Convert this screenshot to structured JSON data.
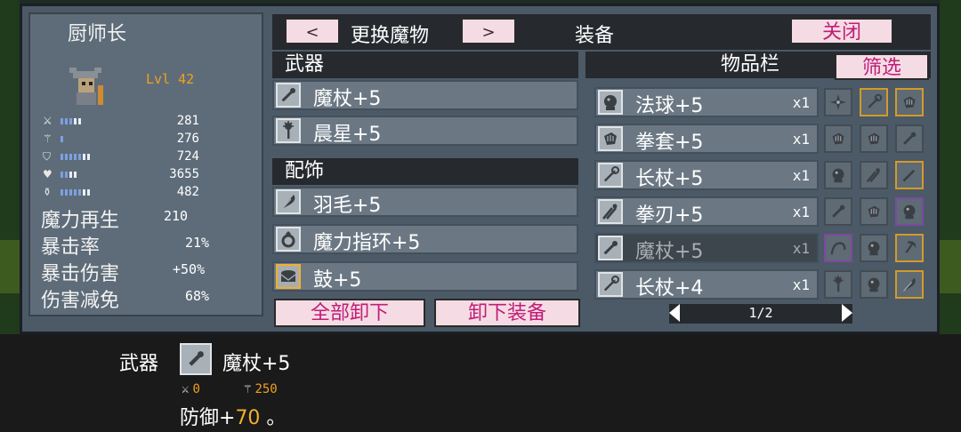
{
  "character": {
    "name": "厨师长",
    "level": "Lvl 42",
    "stats": [
      {
        "icon": "sword-icon",
        "glyph": "⚔",
        "value": "281",
        "fill": 0.45
      },
      {
        "icon": "staff-icon",
        "glyph": "⚚",
        "value": "276",
        "fill": 0.1
      },
      {
        "icon": "shield-icon",
        "glyph": "⛉",
        "value": "724",
        "fill": 0.6
      },
      {
        "icon": "heart-icon",
        "glyph": "♥",
        "value": "3655",
        "fill": 0.4
      },
      {
        "icon": "potion-icon",
        "glyph": "⚱",
        "value": "482",
        "fill": 0.65
      }
    ],
    "attributes": [
      {
        "label": "魔力再生",
        "value": "210"
      },
      {
        "label": "暴击率",
        "value": "21%"
      },
      {
        "label": "暴击伤害",
        "value": "+50%"
      },
      {
        "label": "伤害减免",
        "value": "68%"
      }
    ]
  },
  "header": {
    "prev": "<",
    "change_label": "更换魔物",
    "next": ">",
    "title": "装备",
    "close": "关闭"
  },
  "equipment": {
    "weapon_header": "武器",
    "weapons": [
      {
        "label": "魔杖+5",
        "icon": "wand-icon"
      },
      {
        "label": "晨星+5",
        "icon": "morningstar-icon"
      }
    ],
    "accessory_header": "配饰",
    "accessories": [
      {
        "label": "羽毛+5",
        "icon": "feather-icon",
        "selected": false
      },
      {
        "label": "魔力指环+5",
        "icon": "ring-icon",
        "selected": false
      },
      {
        "label": "鼓+5",
        "icon": "drum-icon",
        "selected": true
      }
    ],
    "unequip_all": "全部卸下",
    "unequip": "卸下装备"
  },
  "inventory": {
    "title": "物品栏",
    "filter": "筛选",
    "items": [
      {
        "label": "法球+5",
        "qty": "x1",
        "icon": "orb-icon",
        "dim": false
      },
      {
        "label": "拳套+5",
        "qty": "x1",
        "icon": "gauntlet-icon",
        "dim": false
      },
      {
        "label": "长杖+5",
        "qty": "x1",
        "icon": "staff-icon",
        "dim": false
      },
      {
        "label": "拳刃+5",
        "qty": "x1",
        "icon": "claw-icon",
        "dim": false
      },
      {
        "label": "魔杖+5",
        "qty": "x1",
        "icon": "wand-icon",
        "dim": true
      },
      {
        "label": "长杖+4",
        "qty": "x1",
        "icon": "staff-icon",
        "dim": false
      }
    ],
    "grid_icons": [
      "shuriken-icon",
      "staff-icon",
      "gauntlet-icon",
      "gauntlet-icon",
      "gauntlet-icon",
      "wand-icon",
      "orb-icon",
      "claw-icon",
      "sword-icon",
      "wand-icon",
      "gauntlet-icon",
      "orb-icon",
      "whip-icon",
      "orb-icon",
      "scythe-icon",
      "morningstar-icon",
      "orb-icon",
      "feather-icon"
    ],
    "grid_borders": [
      "normal",
      "gold",
      "gold",
      "normal",
      "normal",
      "normal",
      "normal",
      "normal",
      "gold",
      "normal",
      "normal",
      "purple",
      "purple",
      "normal",
      "gold",
      "normal",
      "normal",
      "gold"
    ],
    "page": "1/2"
  },
  "tooltip": {
    "category": "武器",
    "item": "魔杖+5",
    "atk": "0",
    "matk": "250",
    "defense_prefix": "防御+",
    "defense_value": "70",
    "defense_suffix": " 。"
  }
}
